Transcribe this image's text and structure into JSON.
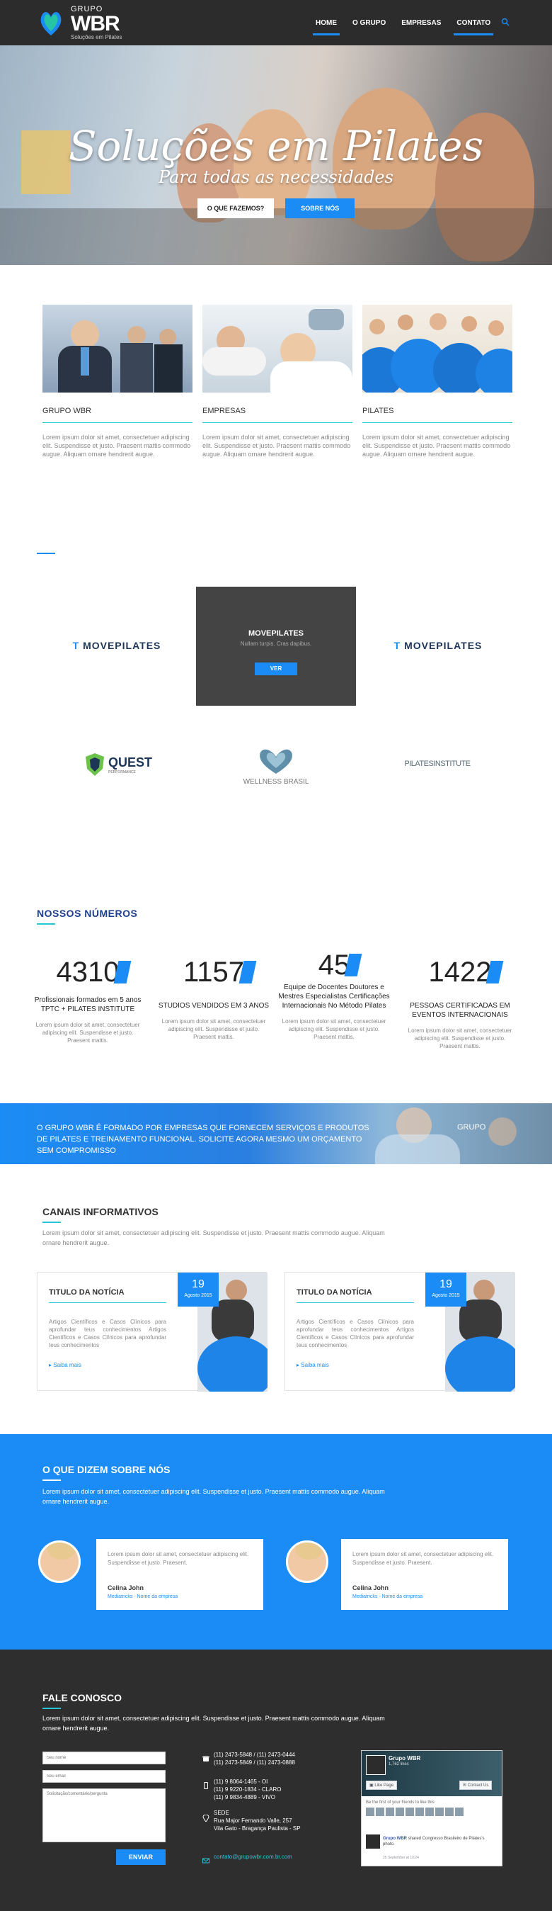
{
  "header": {
    "logo_top": "GRUPO",
    "logo_main": "WBR",
    "logo_sub": "Soluções em Pilates",
    "nav": [
      {
        "label": "HOME",
        "active": true
      },
      {
        "label": "O GRUPO",
        "active": false
      },
      {
        "label": "EMPRESAS",
        "active": false
      },
      {
        "label": "CONTATO",
        "active": true
      }
    ]
  },
  "hero": {
    "title": "Soluções em Pilates",
    "subtitle": "Para todas as necessidades",
    "btn_primary": "O QUE FAZEMOS?",
    "btn_secondary": "SOBRE NÓS"
  },
  "columns": [
    {
      "title": "GRUPO WBR",
      "text": "Lorem ipsum dolor sit amet, consectetuer adipiscing elit. Suspendisse et justo. Praesent mattis commodo augue. Aliquam ornare hendrerit augue."
    },
    {
      "title": "EMPRESAS",
      "text": "Lorem ipsum dolor sit amet, consectetuer adipiscing elit. Suspendisse et justo. Praesent mattis commodo augue. Aliquam ornare hendrerit augue."
    },
    {
      "title": "PILATES",
      "text": "Lorem ipsum dolor sit amet, consectetuer adipiscing elit. Suspendisse et justo. Praesent mattis commodo augue. Aliquam ornare hendrerit augue."
    }
  ],
  "partners": {
    "movepilates_a": "MOVEPILATES",
    "movepilates_b": "MOVEPILATES",
    "overlay_title": "MOVEPILATES",
    "overlay_text": "Nullam turpis. Cras dapibus.",
    "overlay_btn": "VER",
    "quest": "QUEST",
    "quest_sub": "PERFORMANCE",
    "wellness": "WELLNESS BRASIL",
    "institute": "PILATESINSTITUTE"
  },
  "numbers": {
    "title": "NOSSOS NÚMEROS",
    "items": [
      {
        "value": "4310",
        "label": "Profissionais formados em 5 anos TPTC + PILATES INSTITUTE",
        "text": "Lorem ipsum dolor sit amet, consectetuer adipiscing elit. Suspendisse et justo. Praesent mattis."
      },
      {
        "value": "1157",
        "label": "STUDIOS VENDIDOS EM 3 ANOS",
        "text": "Lorem ipsum dolor sit amet, consectetuer adipiscing elit. Suspendisse et justo. Praesent mattis."
      },
      {
        "value": "45",
        "label": "Equipe de Docentes Doutores e Mestres Especialistas Certificações Internacionais No Método Pilates",
        "text": "Lorem ipsum dolor sit amet, consectetuer adipiscing elit. Suspendisse et justo. Praesent mattis."
      },
      {
        "value": "1422",
        "label": "PESSOAS CERTIFICADAS EM EVENTOS INTERNACIONAIS",
        "text": "Lorem ipsum dolor sit amet, consectetuer adipiscing elit. Suspendisse et justo. Praesent mattis."
      }
    ]
  },
  "cta": {
    "text": "O GRUPO WBR É FORMADO POR EMPRESAS QUE FORNECEM SERVIÇOS E PRODUTOS DE PILATES E TREINAMENTO FUNCIONAL. SOLICITE AGORA MESMO UM ORÇAMENTO SEM COMPROMISSO",
    "side": "GRUPO"
  },
  "canais": {
    "title": "CANAIS INFORMATIVOS",
    "text": "Lorem ipsum dolor sit amet, consectetuer adipiscing elit. Suspendisse et justo. Praesent mattis commodo augue. Aliquam ornare hendrerit augue.",
    "news": [
      {
        "title": "TITULO DA NOTÍCIA",
        "text": "Artigos Científicos e Casos Clínicos para aprofundar teus conhecimentos Artigos Científicos e Casos Clínicos para aprofundar teus conhecimentos",
        "link": "Saiba mais",
        "day": "19",
        "month": "Agosto 2015"
      },
      {
        "title": "TITULO DA NOTÍCIA",
        "text": "Artigos Científicos e Casos Clínicos para aprofundar teus conhecimentos Artigos Científicos e Casos Clínicos para aprofundar teus conhecimentos",
        "link": "Saiba mais",
        "day": "19",
        "month": "Agosto 2015"
      }
    ]
  },
  "testimonials": {
    "title": "O QUE DIZEM SOBRE NÓS",
    "text": "Lorem ipsum dolor sit amet, consectetuer adipiscing elit. Suspendisse et justo. Praesent mattis commodo augue. Aliquam ornare hendrerit augue.",
    "items": [
      {
        "text": "Lorem ipsum dolor sit amet, consectetuer adipiscing elit. Suspendisse et justo. Praesent.",
        "name": "Celina John",
        "role": "Mediatricks - Nome da empresa"
      },
      {
        "text": "Lorem ipsum dolor sit amet, consectetuer adipiscing elit. Suspendisse et justo. Praesent.",
        "name": "Celina John",
        "role": "Mediatricks - Nome da empresa"
      }
    ]
  },
  "contact": {
    "title": "FALE CONOSCO",
    "text": "Lorem ipsum dolor sit amet, consectetuer adipiscing elit. Suspendisse et justo. Praesent mattis commodo augue. Aliquam ornare hendrerit augue.",
    "name_placeholder": "Seu nome",
    "email_placeholder": "Seu email",
    "message_placeholder": "Solicitação/comentário/pergunta",
    "send": "ENVIAR",
    "phone1": "(11) 2473-5848 / (11) 2473-0444",
    "phone2": "(11) 2473-5849 / (11) 2473-0888",
    "mobile1": "(11) 9 8064-1465 - OI",
    "mobile2": "(11) 9 9220-1834 - CLARO",
    "mobile3": "(11) 9 9834-4889 - VIVO",
    "addr_label": "SEDE",
    "addr1": "Rua Major Fernando Valle, 257",
    "addr2": "Vila Gato - Bragança Paulista - SP",
    "email": "contato@grupowbr.com.br.com"
  },
  "facebook": {
    "name": "Grupo WBR",
    "likes": "1,762 likes",
    "like_btn": "Like Page",
    "contact_btn": "Contact Us",
    "friends": "Be the first of your friends to like this",
    "post_name": "Grupo WBR",
    "post_text": "shared Congresso Brasileiro de Pilates's photo.",
    "post_time": "25 September at 10:24"
  },
  "colors": {
    "accent": "#1b8cf5",
    "teal": "#26c6d4",
    "dark": "#2c2c2c"
  }
}
